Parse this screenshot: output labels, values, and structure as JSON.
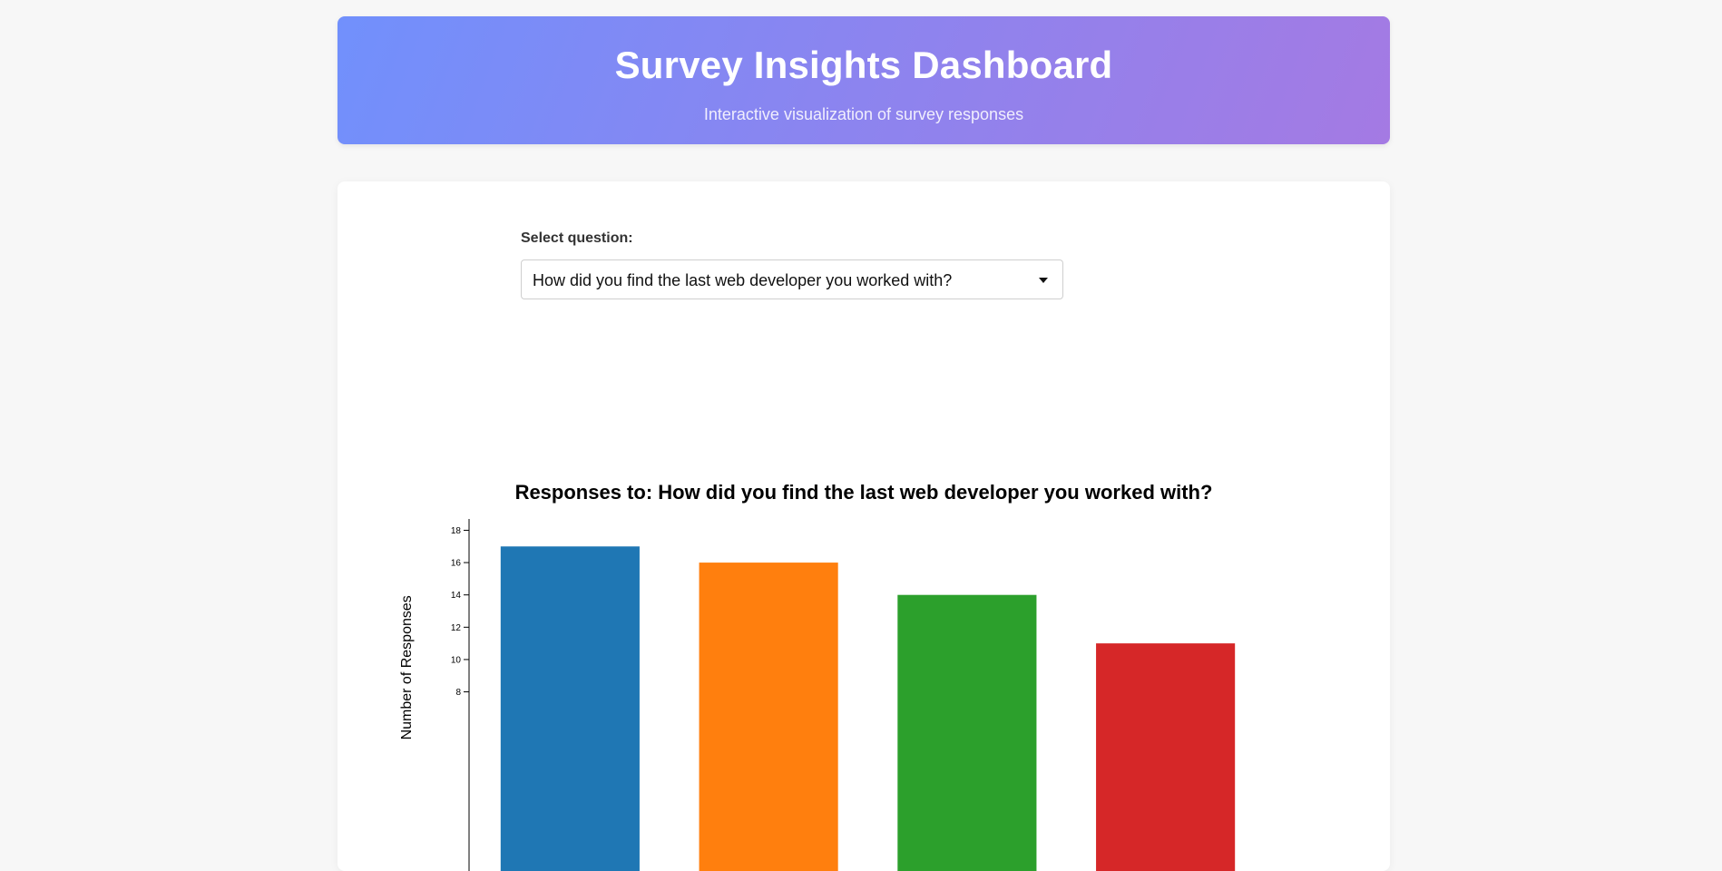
{
  "header": {
    "title": "Survey Insights Dashboard",
    "subtitle": "Interactive visualization of survey responses"
  },
  "controls": {
    "select_label": "Select question:",
    "selected_question": "How did you find the last web developer you worked with?"
  },
  "chart_data": {
    "type": "bar",
    "title": "Responses to: How did you find the last web developer you worked with?",
    "xlabel": "",
    "ylabel": "Number of Responses",
    "categories": [
      "",
      "",
      "",
      ""
    ],
    "values": [
      17,
      16,
      14,
      11
    ],
    "colors": [
      "#1f77b4",
      "#ff7f0e",
      "#2ca02c",
      "#d62728"
    ],
    "ylim": [
      0,
      18.7
    ],
    "yticks": [
      8,
      10,
      12,
      14,
      16,
      18
    ],
    "grid": false
  }
}
